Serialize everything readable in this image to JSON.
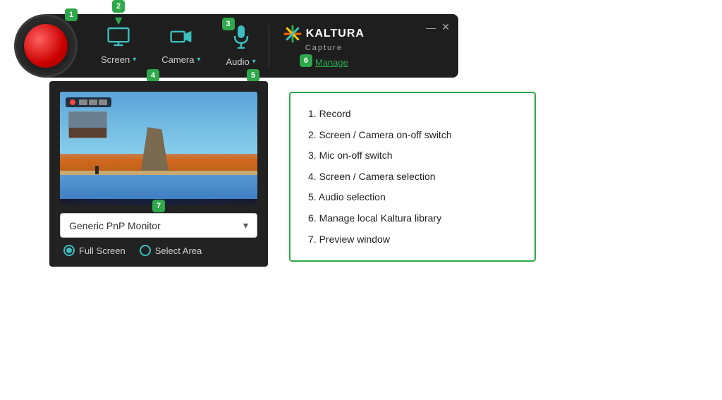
{
  "toolbar": {
    "badge1": "1",
    "badge2": "2",
    "badge3": "3",
    "badge4": "4",
    "badge5": "5",
    "badge6": "6",
    "badge7": "7",
    "screen_label": "Screen",
    "camera_label": "Camera",
    "audio_label": "Audio",
    "manage_label": "Manage",
    "kaltura_name": "KALTURA",
    "kaltura_capture": "Capture",
    "minimize": "—",
    "close": "✕"
  },
  "preview": {
    "monitor_select": "Generic PnP Monitor",
    "full_screen": "Full Screen",
    "select_area": "Select Area"
  },
  "legend": {
    "items": [
      "1.  Record",
      "2.  Screen / Camera on-off switch",
      "3.  Mic on-off switch",
      "4.  Screen / Camera selection",
      "5.  Audio selection",
      "6.  Manage local Kaltura library",
      "7.  Preview window"
    ]
  }
}
